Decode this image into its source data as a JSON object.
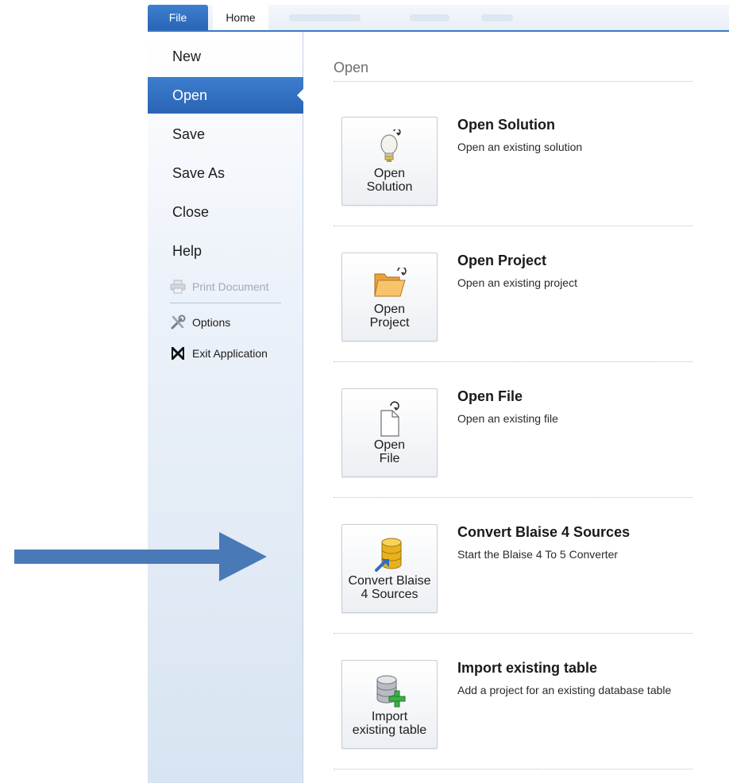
{
  "ribbon": {
    "tabs": [
      {
        "label": "File",
        "active": true
      },
      {
        "label": "Home",
        "active": false
      }
    ]
  },
  "menu": {
    "items": [
      {
        "label": "New"
      },
      {
        "label": "Open",
        "active": true
      },
      {
        "label": "Save"
      },
      {
        "label": "Save As"
      },
      {
        "label": "Close"
      },
      {
        "label": "Help"
      }
    ],
    "small_items": [
      {
        "label": "Print Document",
        "icon": "printer-icon",
        "disabled": true
      },
      {
        "label": "Options",
        "icon": "tools-icon",
        "disabled": false
      },
      {
        "label": "Exit Application",
        "icon": "exit-x-icon",
        "disabled": false
      }
    ]
  },
  "main": {
    "section_title": "Open",
    "options": [
      {
        "button_label": "Open\nSolution",
        "title": "Open Solution",
        "description": "Open an existing solution",
        "icon": "lightbulb-icon"
      },
      {
        "button_label": "Open\nProject",
        "title": "Open Project",
        "description": "Open an existing project",
        "icon": "folder-open-icon"
      },
      {
        "button_label": "Open\nFile",
        "title": "Open File",
        "description": "Open an existing file",
        "icon": "file-open-icon"
      },
      {
        "button_label": "Convert Blaise\n4 Sources",
        "title": "Convert Blaise 4 Sources",
        "description": "Start the Blaise 4 To 5 Converter",
        "icon": "database-convert-icon"
      },
      {
        "button_label": "Import\nexisting table",
        "title": "Import existing table",
        "description": "Add a project for an existing database table",
        "icon": "database-add-icon"
      }
    ]
  },
  "colors": {
    "accent": "#2f6ec2",
    "arrow": "#4a79b8",
    "sidebar_bottom": "#d8e4f2"
  }
}
